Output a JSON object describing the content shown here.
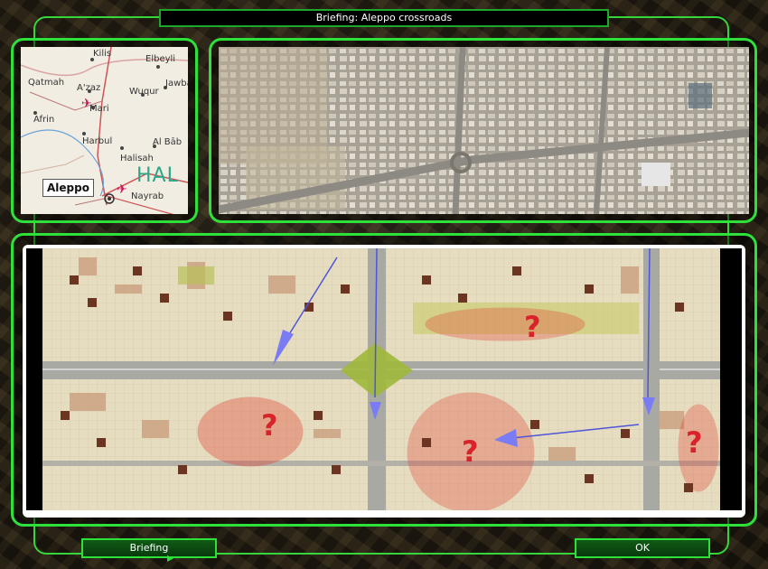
{
  "window": {
    "title": "Briefing:  Aleppo crossroads"
  },
  "region_map": {
    "labels": [
      {
        "key": "kilis",
        "text": "Kilis"
      },
      {
        "key": "elbeyli",
        "text": "Elbeyli"
      },
      {
        "key": "qatmah",
        "text": "Qatmah"
      },
      {
        "key": "azaz",
        "text": "A'zaz"
      },
      {
        "key": "wuqur",
        "text": "Wuqur"
      },
      {
        "key": "jawba",
        "text": "Jawba"
      },
      {
        "key": "afrin",
        "text": "Afrin"
      },
      {
        "key": "mari",
        "text": "Mari"
      },
      {
        "key": "harbul",
        "text": "Harbul"
      },
      {
        "key": "albab",
        "text": "Al Bāb"
      },
      {
        "key": "halisah",
        "text": "Halisah"
      },
      {
        "key": "nayrab",
        "text": "Nayrab"
      }
    ],
    "city_label": "Aleppo",
    "province_label": "HAL"
  },
  "tactical_map": {
    "marker": "?",
    "zone_color": "#e23a2c",
    "arrow_color": "#7a7cf4"
  },
  "buttons": {
    "briefing": "Briefing",
    "ok": "OK"
  },
  "icons": {
    "cursor": "cursor-arrow-icon",
    "airport": "airport-icon"
  }
}
